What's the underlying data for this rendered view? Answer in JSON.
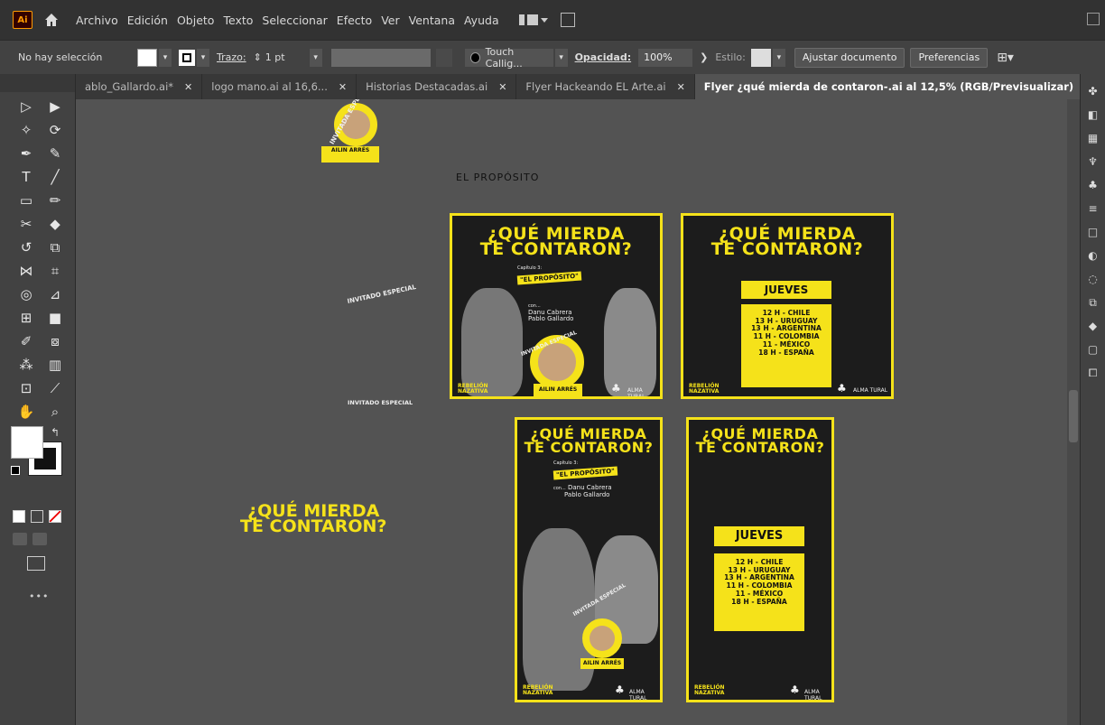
{
  "app": {
    "logo": "Ai"
  },
  "menu": [
    "Archivo",
    "Edición",
    "Objeto",
    "Texto",
    "Seleccionar",
    "Efecto",
    "Ver",
    "Ventana",
    "Ayuda"
  ],
  "control": {
    "selection": "No hay selección",
    "stroke_label": "Trazo:",
    "stroke_value": "1 pt",
    "brush_name": "Touch Callig...",
    "opacity_label": "Opacidad:",
    "opacity_value": "100%",
    "style_label": "Estilo:",
    "fit_button": "Ajustar documento",
    "prefs_button": "Preferencias"
  },
  "tabs": [
    {
      "label": "ablo_Gallardo.ai*",
      "active": false
    },
    {
      "label": "logo mano.ai al 16,6...",
      "active": false
    },
    {
      "label": "Historias Destacadas.ai",
      "active": false
    },
    {
      "label": "Flyer Hackeando EL Arte.ai",
      "active": false
    },
    {
      "label": "Flyer ¿qué mierda de contaron-.ai al 12,5% (RGB/Previsualizar)",
      "active": true
    }
  ],
  "tab_overflow": "»",
  "canvas": {
    "label_proposito": "EL PROPÓSITO",
    "invitado_arc": "INVITADO ESPECIAL",
    "invitado_flat": "INVITADO   ESPECIAL",
    "loose_title_1": "¿QUÉ MIERDA",
    "loose_title_2": "TE CONTARON?",
    "badge_invitada": "INVITADA ESPECIAL",
    "badge_name": "AILIN ARRÉS"
  },
  "flyer": {
    "title_1": "¿QUÉ MIERDA",
    "title_2": "TE CONTARON?",
    "chapter": "Capítulo 3:",
    "subtitle": "\"EL PROPÓSITO\"",
    "con": "con...",
    "guest_1": "Danu Cabrera",
    "guest_2": "Pablo Gallardo",
    "invitada": "INVITADA ESPECIAL",
    "invitee": "AILIN ARRÉS",
    "brand_left_1": "REBELIÓN",
    "brand_left_2": "NAZATIVA",
    "brand_right": "ALMA TURAL",
    "day": "JUEVES",
    "schedule": [
      "12 H - CHILE",
      "13 H - URUGUAY",
      "13 H - ARGENTINA",
      "11 H - COLOMBIA",
      "11 - MÉXICO",
      "18 H - ESPAÑA"
    ]
  },
  "colors": {
    "accent": "#f5e21a",
    "canvas": "#535353",
    "panel": "#424242"
  }
}
